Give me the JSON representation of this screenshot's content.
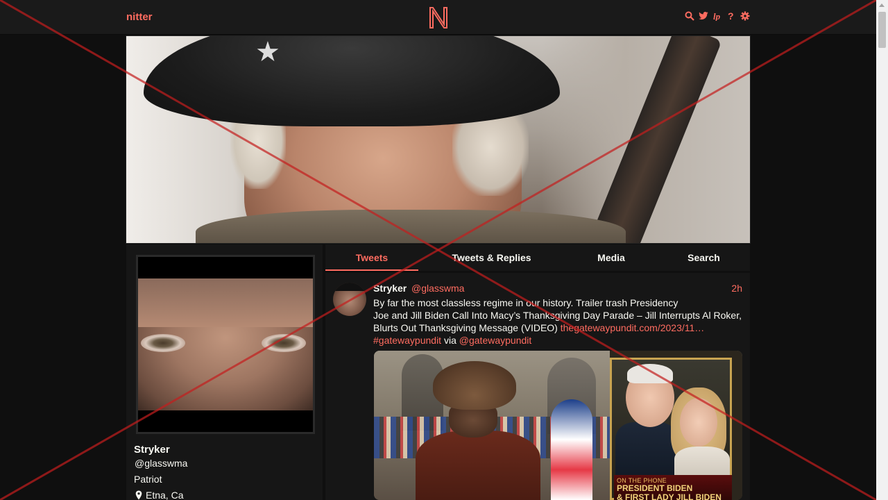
{
  "nav": {
    "brand": "nitter",
    "center_logo": "N",
    "icons": [
      "search-icon",
      "twitter-icon",
      "rss-icon",
      "help-icon",
      "settings-icon"
    ],
    "accent_color": "#ff6c60"
  },
  "profile": {
    "fullname": "Stryker",
    "username": "@glasswma",
    "bio": "Patriot",
    "location": "Etna, Ca"
  },
  "tabs": [
    {
      "label": "Tweets",
      "active": true
    },
    {
      "label": "Tweets & Replies",
      "active": false
    },
    {
      "label": "Media",
      "active": false
    },
    {
      "label": "Search",
      "active": false
    }
  ],
  "tweet": {
    "fullname": "Stryker",
    "username": "@glasswma",
    "date": "2h",
    "line1": "By far the most classless regime in our history. Trailer trash Presidency",
    "line2": "Joe and Jill Biden Call Into Macy’s Thanksgiving Day Parade – Jill Interrupts Al Roker,",
    "line3_text": "Blurts Out Thanksgiving Message (VIDEO) ",
    "link_text": "thegatewaypundit.com/2023/11…",
    "hashtag": "#gatewaypundit",
    "via_text": " via ",
    "mention": "@gatewaypundit",
    "media": {
      "chyron_top": "ON THE PHONE",
      "chyron_line1": "PRESIDENT BIDEN",
      "chyron_line2": "& FIRST LADY JILL BIDEN"
    }
  }
}
